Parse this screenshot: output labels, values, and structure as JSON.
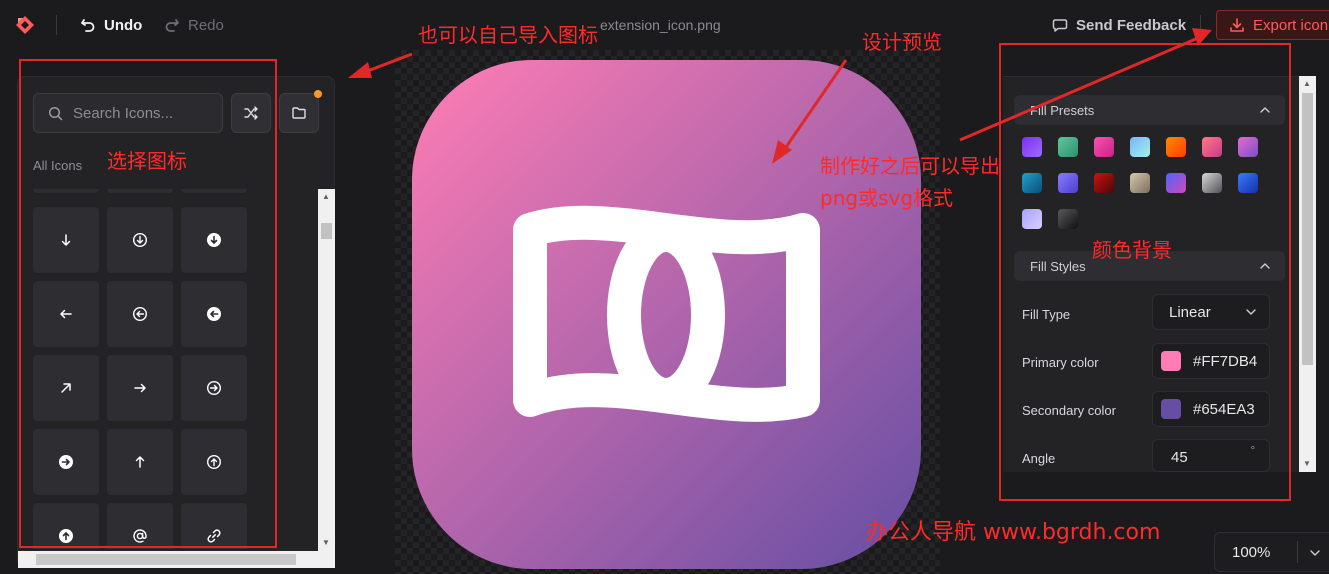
{
  "topbar": {
    "undo_label": "Undo",
    "redo_label": "Redo",
    "filename": "extension_icon.png",
    "feedback_label": "Send Feedback",
    "export_label": "Export icon"
  },
  "left_panel": {
    "search_placeholder": "Search Icons...",
    "section_label": "All Icons",
    "icons": [
      "arrow-down-icon",
      "arrow-down-circle-icon",
      "arrow-down-circle-filled-icon",
      "arrow-left-icon",
      "arrow-left-circle-icon",
      "arrow-left-circle-filled-icon",
      "arrow-up-right-icon",
      "arrow-right-icon",
      "arrow-right-circle-icon",
      "arrow-right-circle-filled-icon",
      "arrow-up-icon",
      "arrow-up-circle-icon",
      "arrow-up-circle-filled-icon",
      "at-sign-icon",
      "link-icon"
    ]
  },
  "preview": {
    "icon": "banknote-icon",
    "gradient": {
      "primary": "#FF7DB4",
      "secondary": "#654EA3",
      "angle": 45
    }
  },
  "right_panel": {
    "fill_presets_title": "Fill Presets",
    "presets": [
      [
        "#7a2ff2",
        "#a06cff"
      ],
      [
        "#5fc7a0",
        "#2f8f6c"
      ],
      [
        "#ff4fb0",
        "#c12587"
      ],
      [
        "#74b6ff",
        "#a6f0e6"
      ],
      [
        "#ff8a00",
        "#ff3d00"
      ],
      [
        "#ff7a85",
        "#c73a8a"
      ],
      [
        "#e36bd1",
        "#7b4ec7"
      ],
      [
        "#1fa2c9",
        "#0b4f7a"
      ],
      [
        "#8a7bff",
        "#4b3fd0"
      ],
      [
        "#cf1111",
        "#4a0606"
      ],
      [
        "#d8c8a8",
        "#7a7060"
      ],
      [
        "#4e63ff",
        "#d14ab4"
      ],
      [
        "#d8d8d8",
        "#505058"
      ],
      [
        "#3a7bff",
        "#1530a8"
      ],
      [
        "#a8a0ff",
        "#d8d0ff"
      ],
      [
        "#5a5a5e",
        "#101010"
      ]
    ],
    "fill_styles_title": "Fill Styles",
    "fill_type_label": "Fill Type",
    "fill_type_value": "Linear",
    "primary_label": "Primary color",
    "primary_value": "#FF7DB4",
    "secondary_label": "Secondary color",
    "secondary_value": "#654EA3",
    "angle_label": "Angle",
    "angle_value": "45",
    "angle_unit": "°"
  },
  "zoom": {
    "value": "100%"
  },
  "annotations": {
    "import_note": "也可以自己导入图标",
    "choose_note": "选择图标",
    "preview_note": "设计预览",
    "export_note_1": "制作好之后可以导出",
    "export_note_2": "png或svg格式",
    "color_note": "颜色背景",
    "site_note": "办公人导航  www.bgrdh.com",
    "color": "#ff2a2a"
  }
}
